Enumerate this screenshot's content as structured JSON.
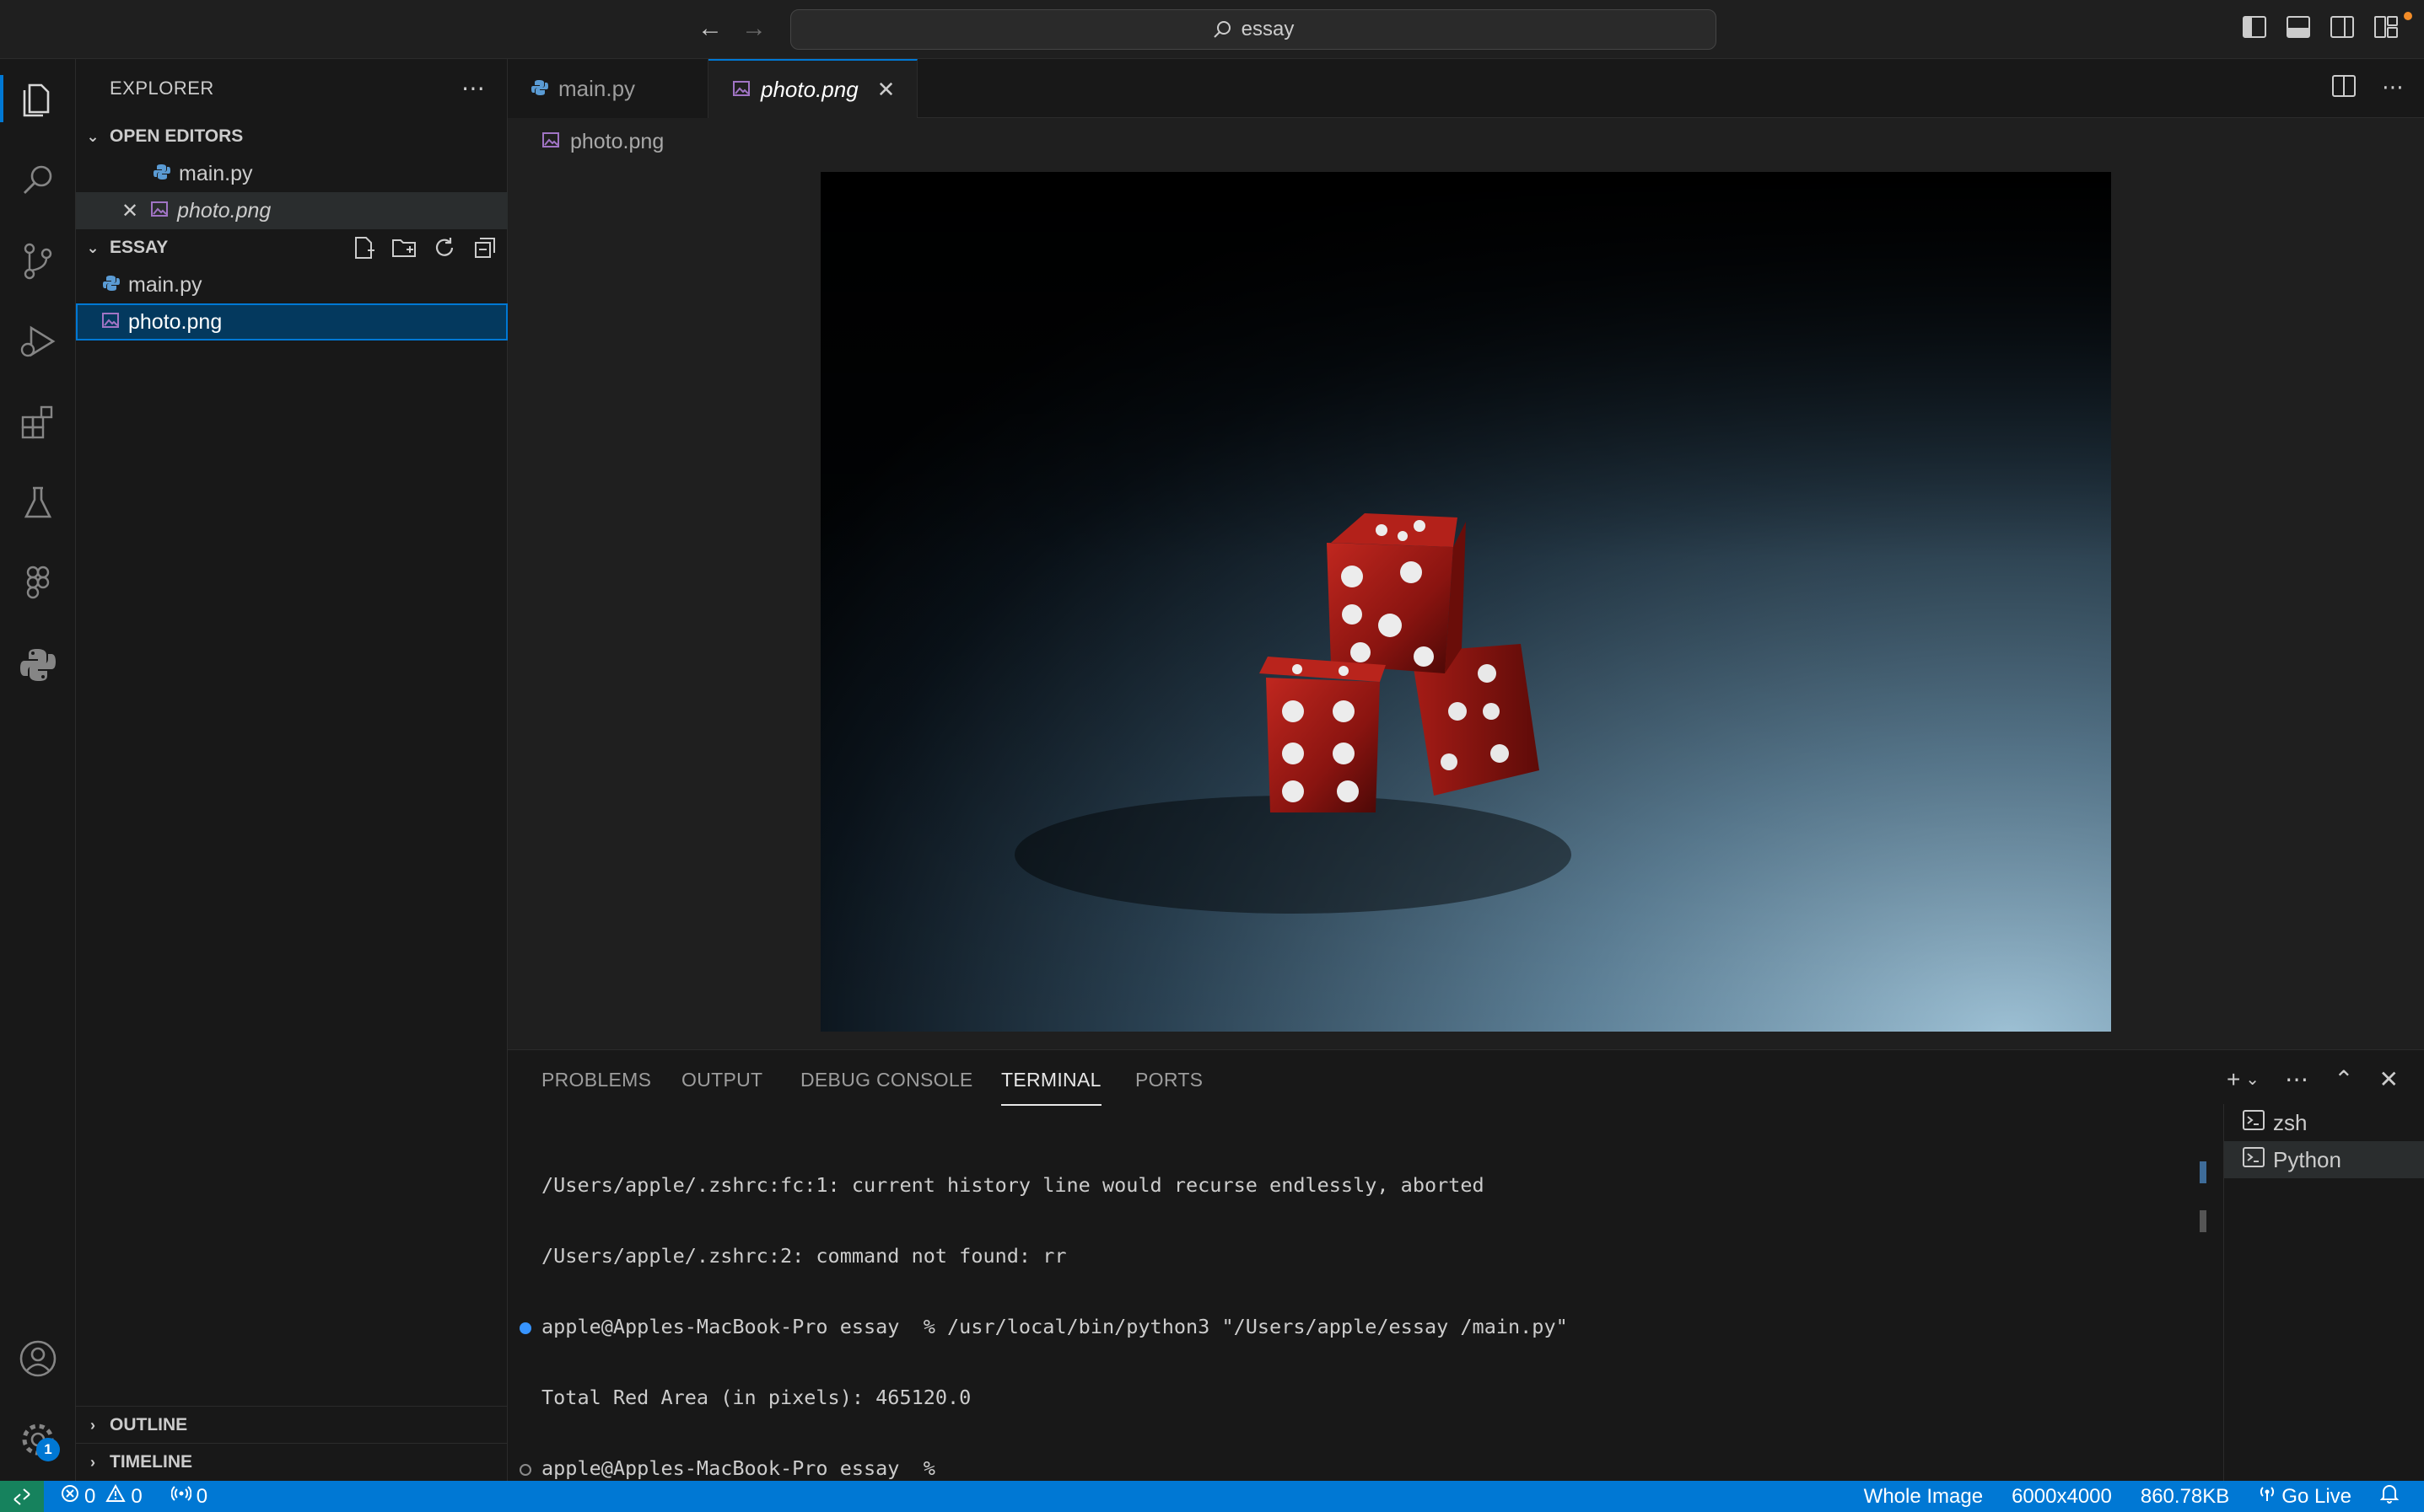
{
  "titlebar": {
    "search_text": "essay",
    "icons": [
      "arrow-left-icon",
      "arrow-right-icon",
      "search-icon",
      "toggle-sidebar-icon",
      "toggle-panel-icon",
      "toggle-secondary-sidebar-icon",
      "customize-layout-icon"
    ]
  },
  "activitybar": {
    "items": [
      "explorer-icon",
      "search-icon",
      "source-control-icon",
      "run-debug-icon",
      "extensions-icon",
      "testing-icon",
      "figma-icon",
      "python-icon"
    ],
    "bottom": [
      "accounts-icon",
      "settings-gear-icon"
    ],
    "settings_badge": "1"
  },
  "sidebar": {
    "title": "EXPLORER",
    "open_editors": {
      "label": "OPEN EDITORS",
      "files": [
        {
          "name": "main.py",
          "icon": "python-file-icon"
        },
        {
          "name": "photo.png",
          "icon": "image-file-icon"
        }
      ]
    },
    "folder": {
      "label": "ESSAY",
      "files": [
        {
          "name": "main.py",
          "icon": "python-file-icon"
        },
        {
          "name": "photo.png",
          "icon": "image-file-icon"
        }
      ]
    },
    "outline_label": "OUTLINE",
    "timeline_label": "TIMELINE"
  },
  "editor": {
    "tabs": [
      {
        "label": "main.py",
        "active": false
      },
      {
        "label": "photo.png",
        "active": true
      }
    ],
    "breadcrumb": "photo.png"
  },
  "panel": {
    "tabs": [
      "PROBLEMS",
      "OUTPUT",
      "DEBUG CONSOLE",
      "TERMINAL",
      "PORTS"
    ],
    "active_tab": "TERMINAL",
    "terminal_lines": [
      "/Users/apple/.zshrc:fc:1: current history line would recurse endlessly, aborted",
      "/Users/apple/.zshrc:2: command not found: rr",
      "apple@Apples-MacBook-Pro essay  % /usr/local/bin/python3 \"/Users/apple/essay /main.py\"",
      "Total Red Area (in pixels): 465120.0",
      "apple@Apples-MacBook-Pro essay  % "
    ],
    "terminals": [
      "zsh",
      "Python"
    ]
  },
  "statusbar": {
    "errors": "0",
    "warnings": "0",
    "ports": "0",
    "whole_image": "Whole Image",
    "dimensions": "6000x4000",
    "file_size": "860.78KB",
    "go_live": "Go Live"
  },
  "colors": {
    "accent": "#0078d4",
    "statusbar": "#0078d4",
    "remote": "#16825d",
    "python_blue": "#5a9bd4",
    "image_icon_purple": "#a074c4"
  }
}
